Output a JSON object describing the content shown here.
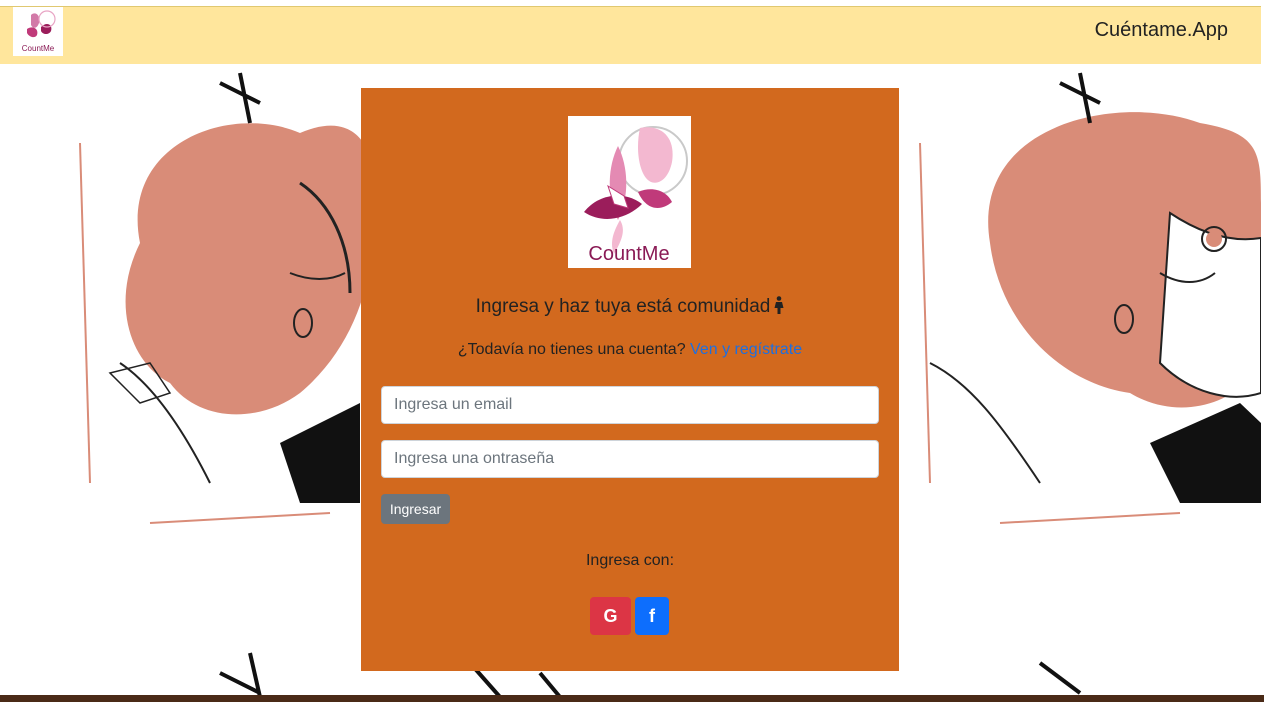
{
  "navbar": {
    "brand": "Cuéntame.App",
    "logo_text": "CountMe",
    "bg_color": "#ffe69c"
  },
  "card": {
    "logo_text": "CountMe",
    "headline": "Ingresa y haz tuya está comunidad",
    "headline_icon": "woman-icon",
    "register_prompt": "¿Todavía no tienes una cuenta?",
    "register_link": "Ven y regístrate",
    "email_placeholder": "Ingresa un email",
    "password_placeholder": "Ingresa una ontraseña",
    "login_button": "Ingresar",
    "social_label": "Ingresa con:",
    "social": [
      {
        "name": "google",
        "icon": "google-icon",
        "color": "#dc3545"
      },
      {
        "name": "facebook",
        "icon": "facebook-icon",
        "color": "#0d6efd"
      }
    ],
    "bg_color": "#d2691e"
  }
}
